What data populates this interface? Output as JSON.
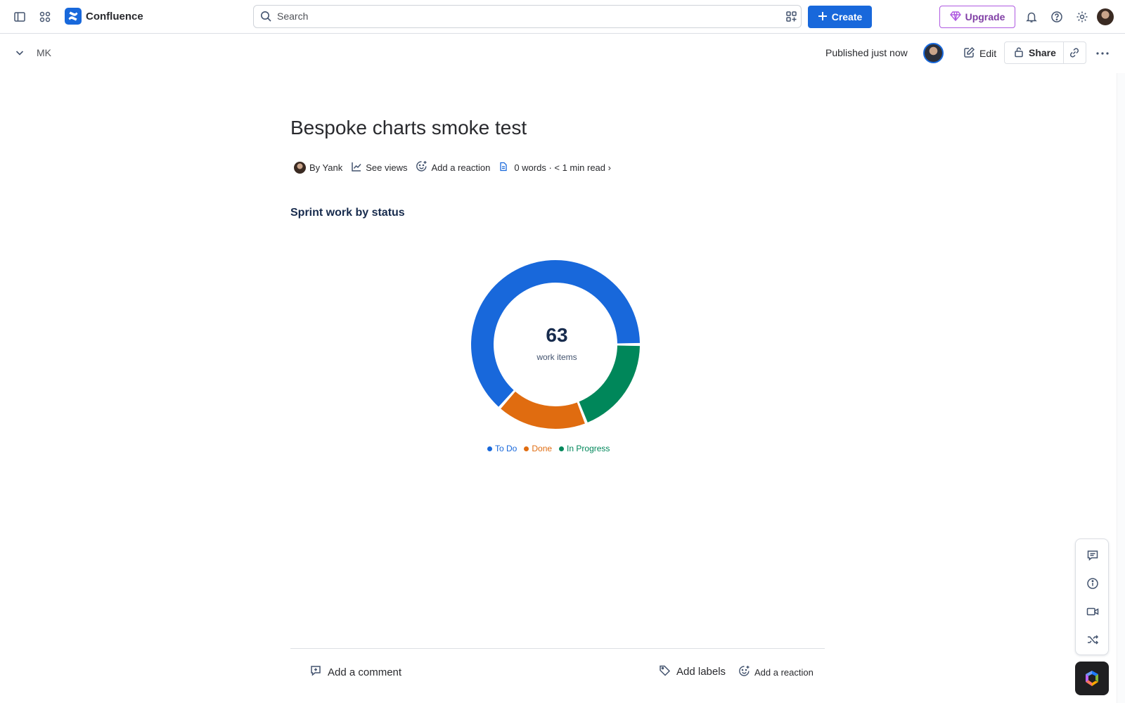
{
  "topbar": {
    "brand": "Confluence",
    "search_placeholder": "Search",
    "create_label": "Create",
    "upgrade_label": "Upgrade"
  },
  "subbar": {
    "space_key": "MK",
    "published": "Published just now",
    "edit_label": "Edit",
    "share_label": "Share"
  },
  "page": {
    "title": "Bespoke charts smoke test",
    "byline": {
      "author": "By Yank",
      "see_views": "See views",
      "add_reaction": "Add a reaction",
      "read_info": "0 words · < 1 min read ›"
    },
    "chart_heading": "Sprint work by status"
  },
  "chart_data": {
    "type": "pie",
    "title": "Sprint work by status",
    "center_value": "63",
    "center_label": "work items",
    "series": [
      {
        "name": "To Do",
        "value": 40,
        "color": "#1868db"
      },
      {
        "name": "Done",
        "value": 11,
        "color": "#e06c10"
      },
      {
        "name": "In Progress",
        "value": 12,
        "color": "#00875a"
      }
    ]
  },
  "footer": {
    "add_comment": "Add a comment",
    "add_labels": "Add labels",
    "add_reaction": "Add a reaction"
  },
  "icons": [
    "sidebar-toggle-icon",
    "app-switcher-icon",
    "confluence-logo-icon",
    "search-icon",
    "filter-icon",
    "plus-icon",
    "gem-icon",
    "bell-icon",
    "help-icon",
    "gear-icon",
    "chevron-down-icon",
    "pencil-icon",
    "lock-icon",
    "link-icon",
    "more-icon",
    "chart-icon",
    "emoji-add-icon",
    "doc-icon",
    "comment-add-icon",
    "tag-icon",
    "comment-icon",
    "info-icon",
    "video-icon",
    "shuffle-icon",
    "rovo-icon"
  ]
}
